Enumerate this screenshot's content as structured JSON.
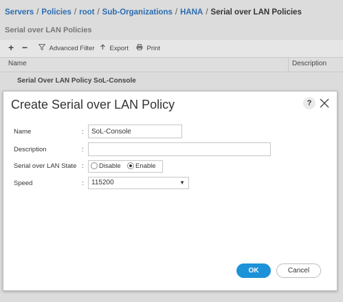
{
  "breadcrumb": {
    "items": [
      "Servers",
      "Policies",
      "root",
      "Sub-Organizations",
      "HANA"
    ],
    "current": "Serial over LAN Policies",
    "separator": "/"
  },
  "panel": {
    "title": "Serial over LAN Policies"
  },
  "toolbar": {
    "add_label": "+",
    "remove_label": "−",
    "advanced_filter_label": "Advanced Filter",
    "export_label": "Export",
    "print_label": "Print"
  },
  "table": {
    "columns": [
      "Name",
      "Description"
    ],
    "rows": [
      {
        "name": "Serial Over LAN Policy SoL-Console"
      }
    ]
  },
  "dialog": {
    "title": "Create Serial over LAN Policy",
    "help_label": "?",
    "fields": {
      "name": {
        "label": "Name",
        "value": "SoL-Console"
      },
      "description": {
        "label": "Description",
        "value": ""
      },
      "sol_state": {
        "label": "Serial over LAN State",
        "options": [
          "Disable",
          "Enable"
        ],
        "selected": "Enable"
      },
      "speed": {
        "label": "Speed",
        "value": "115200"
      }
    },
    "colon": ":",
    "ok_label": "OK",
    "cancel_label": "Cancel"
  },
  "colors": {
    "link": "#2b6cb0",
    "primary_button": "#1e92d8"
  },
  "icons": [
    "filter-icon",
    "export-icon",
    "print-icon",
    "help-icon",
    "close-icon",
    "chevron-down-icon"
  ]
}
